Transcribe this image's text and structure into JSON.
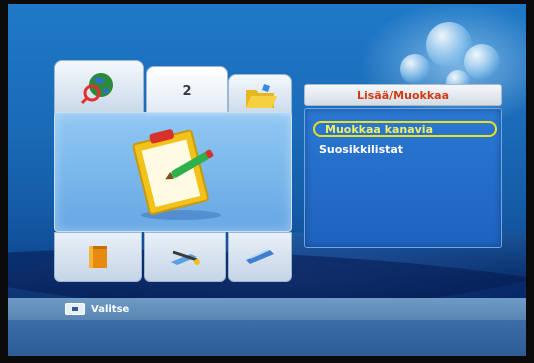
{
  "menu": {
    "active_tab_number": "2",
    "top_tabs": [
      {
        "icon": "globe-search-icon"
      },
      {
        "icon": "number-2"
      },
      {
        "icon": "folder-open-icon"
      }
    ],
    "center_icon": "clipboard-edit-icon",
    "bottom_tabs": [
      {
        "icon": "book-icon"
      },
      {
        "icon": "tools-icon"
      },
      {
        "icon": "remote-icon"
      }
    ]
  },
  "submenu": {
    "title": "Lisää/Muokkaa",
    "items": [
      {
        "label": "Muokkaa kanavia",
        "selected": true
      },
      {
        "label": "Suosikkilistat",
        "selected": false
      }
    ]
  },
  "helpbar": {
    "key_icon": "key-button-icon",
    "label": "Valitse"
  },
  "colors": {
    "title_text": "#d23a14",
    "selection_border": "#e8e020",
    "selection_text": "#f4f060",
    "background": "#1a6bb8"
  }
}
